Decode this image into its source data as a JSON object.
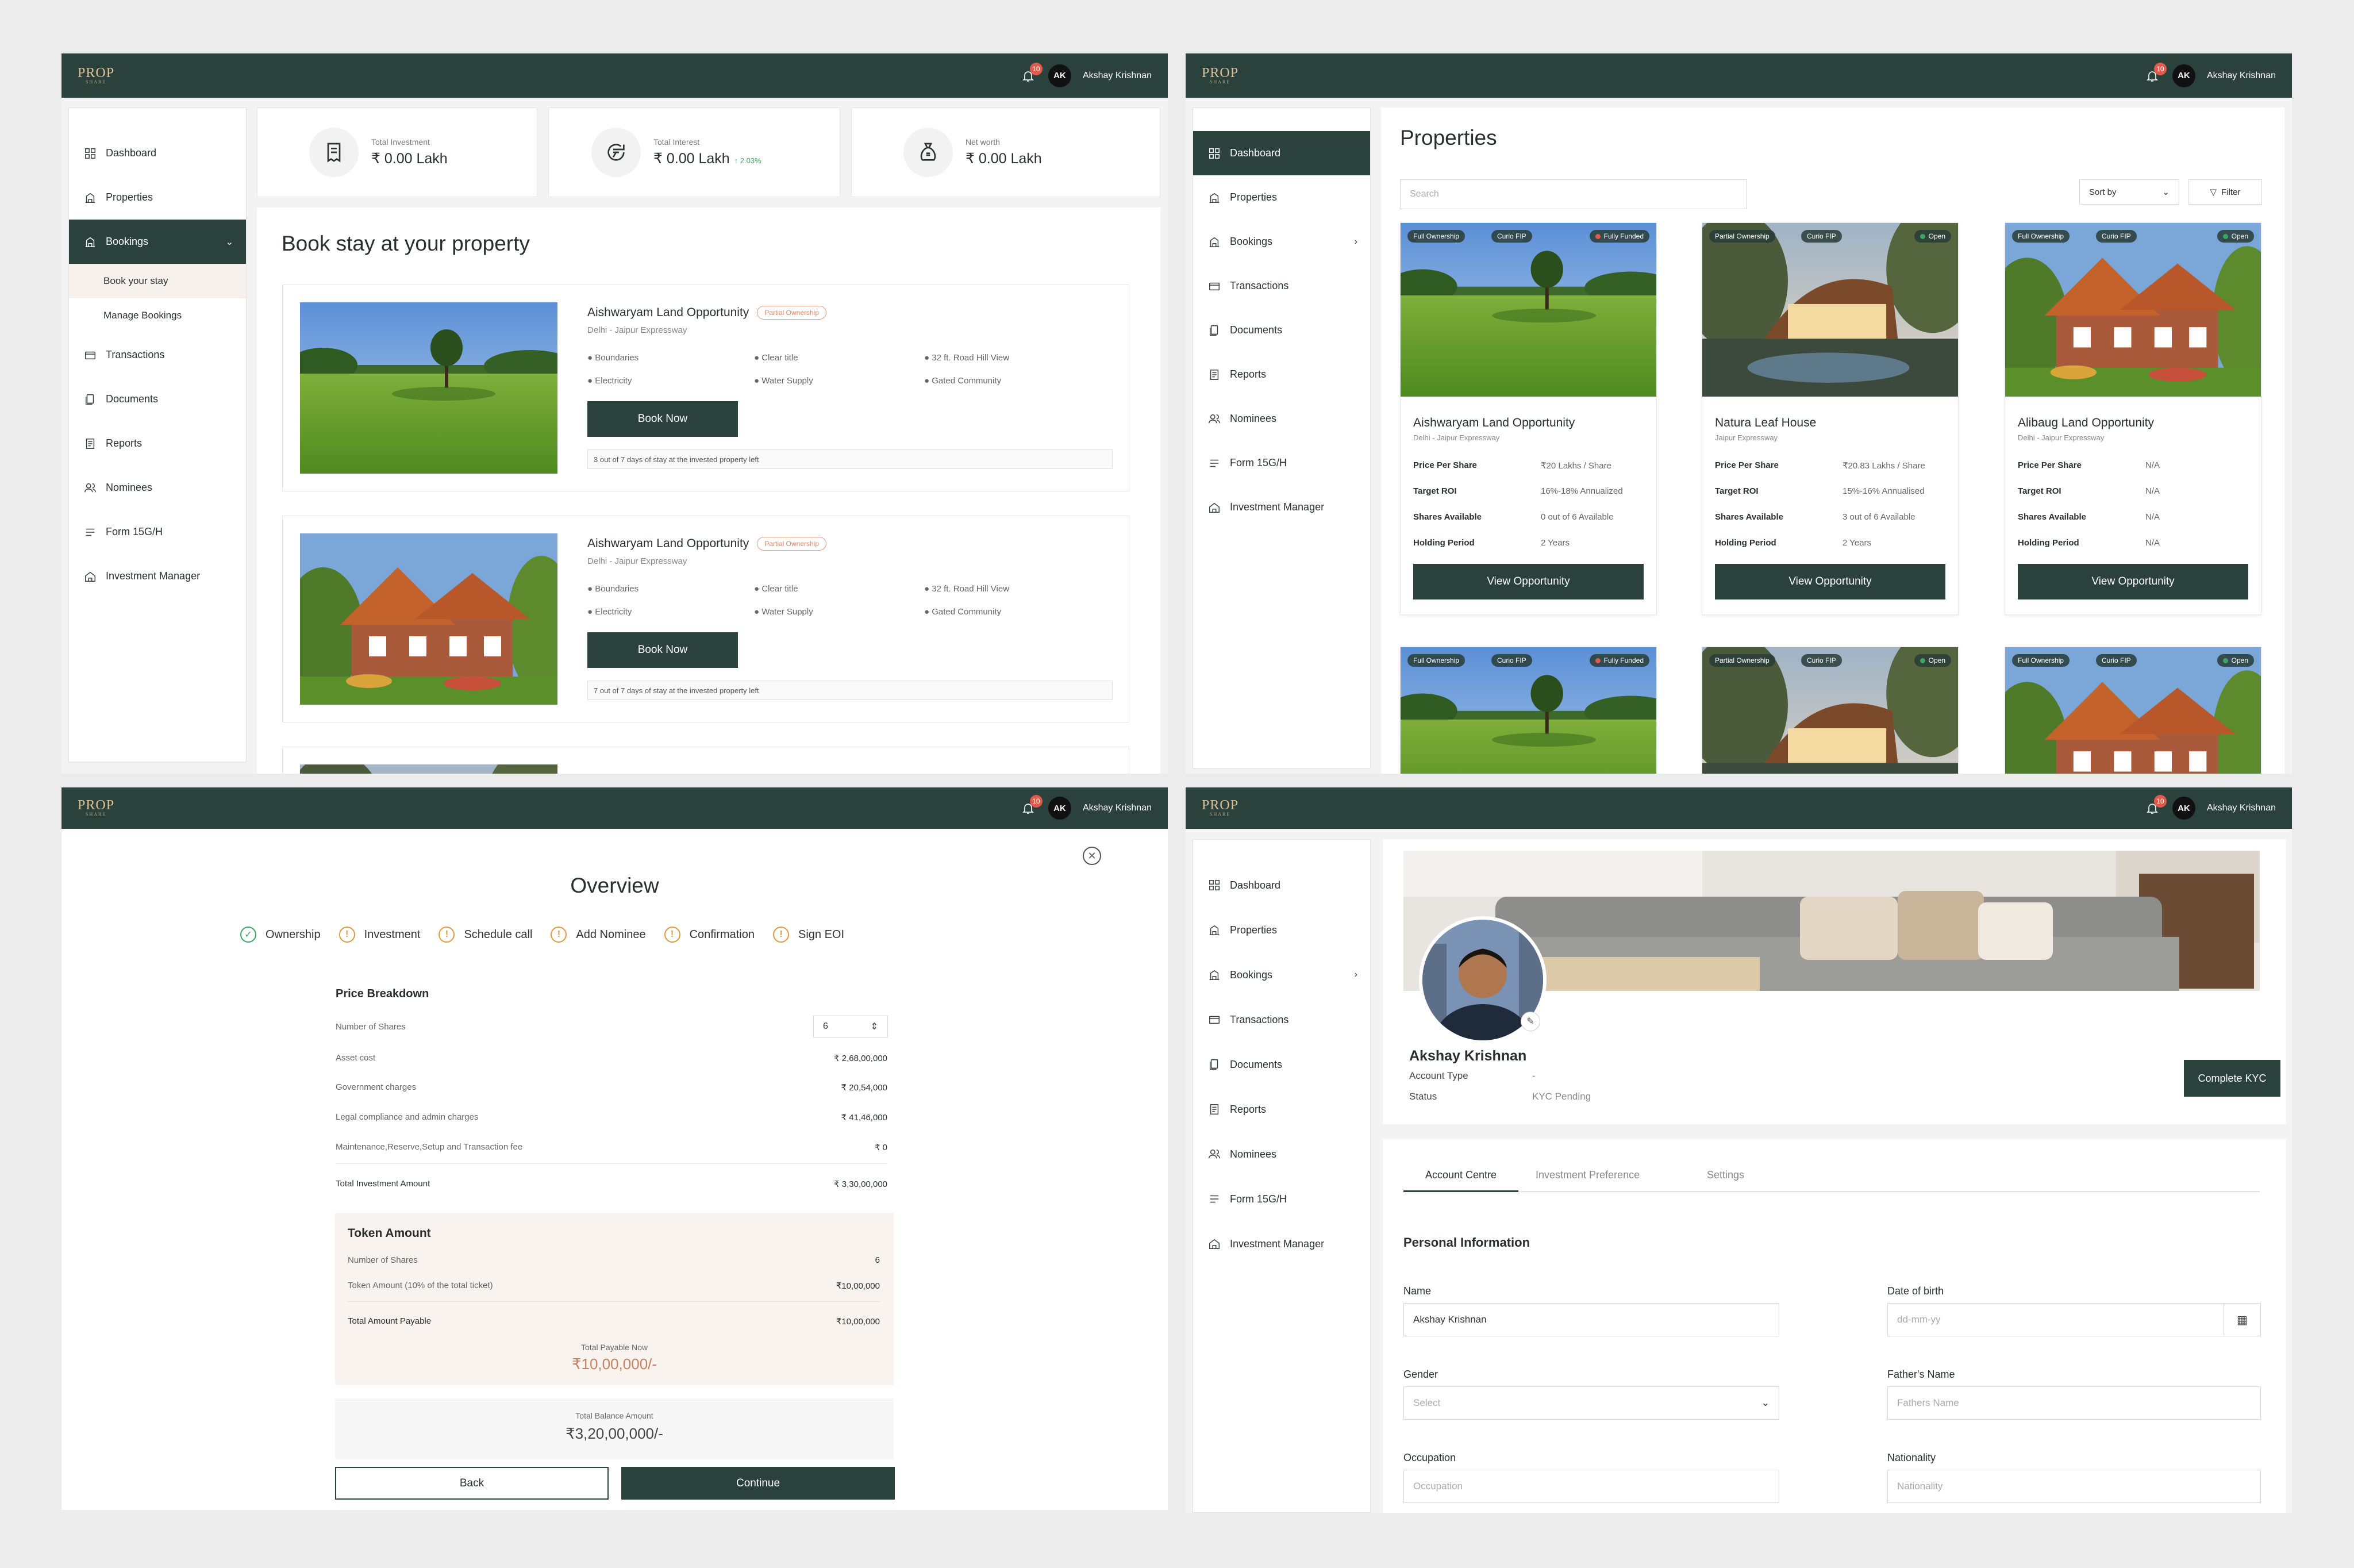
{
  "app": {
    "logo": "PROP",
    "logo_sub": "SHARE",
    "notifications": "10",
    "user_initials": "AK",
    "user_name": "Akshay Krishnan"
  },
  "colors": {
    "brand": "#2a423b",
    "accent": "#d9c09a",
    "warning": "#e09a3f",
    "success": "#3aa662"
  },
  "sidebar": {
    "items": [
      "Dashboard",
      "Properties",
      "Bookings",
      "Transactions",
      "Documents",
      "Reports",
      "Nominees",
      "Form 15G/H",
      "Investment Manager"
    ],
    "sub_items": [
      "Book your stay",
      "Manage Bookings"
    ]
  },
  "stats": [
    {
      "label": "Total Investment",
      "value": "₹ 0.00 Lakh",
      "icon": "receipt-icon"
    },
    {
      "label": "Total Interest",
      "value": "₹ 0.00 Lakh",
      "delta": "↑ 2.03%",
      "icon": "rupee-refresh-icon"
    },
    {
      "label": "Net worth",
      "value": "₹ 0.00 Lakh",
      "icon": "money-bag-icon"
    }
  ],
  "book_stay": {
    "title": "Book stay at your property",
    "properties": [
      {
        "name": "Aishwaryam Land Opportunity",
        "badge": "Partial Ownership",
        "location": "Delhi - Jaipur Expressway",
        "features": [
          "Boundaries",
          "Clear title",
          "32 ft. Road Hill View",
          "Electricity",
          "Water Supply",
          "Gated Community"
        ],
        "button": "Book Now",
        "stay_info": "3 out of 7 days of stay at the invested property left"
      },
      {
        "name": "Aishwaryam Land Opportunity",
        "badge": "Partial Ownership",
        "location": "Delhi - Jaipur Expressway",
        "features": [
          "Boundaries",
          "Clear title",
          "32 ft. Road Hill View",
          "Electricity",
          "Water Supply",
          "Gated Community"
        ],
        "button": "Book Now",
        "stay_info": "7 out of 7 days of stay at the invested property left"
      }
    ]
  },
  "properties_page": {
    "title": "Properties",
    "search_placeholder": "Search",
    "sort_label": "Sort by",
    "filter_label": "Filter",
    "cards": [
      {
        "tags": [
          "Full Ownership",
          "Curio FIP"
        ],
        "status": "Fully Funded",
        "name": "Aishwaryam Land Opportunity",
        "location": "Delhi - Jaipur Expressway",
        "rows": [
          [
            "Price Per Share",
            "₹20 Lakhs / Share"
          ],
          [
            "Target ROI",
            "16%-18% Annualized"
          ],
          [
            "Shares Available",
            "0 out of 6  Available"
          ],
          [
            "Holding Period",
            "2 Years"
          ]
        ],
        "button": "View Opportunity"
      },
      {
        "tags": [
          "Partial Ownership",
          "Curio FIP"
        ],
        "status": "Open",
        "name": "Natura Leaf House",
        "location": "Jaipur Expressway",
        "rows": [
          [
            "Price Per Share",
            "₹20.83 Lakhs / Share"
          ],
          [
            "Target ROI",
            "15%-16% Annualised"
          ],
          [
            "Shares Available",
            "3 out of 6 Available"
          ],
          [
            "Holding Period",
            "2 Years"
          ]
        ],
        "button": "View Opportunity"
      },
      {
        "tags": [
          "Full Ownership",
          "Curio FIP"
        ],
        "status": "Open",
        "name": "Alibaug Land Opportunity",
        "location": "Delhi - Jaipur Expressway",
        "rows": [
          [
            "Price Per Share",
            "N/A"
          ],
          [
            "Target ROI",
            "N/A"
          ],
          [
            "Shares Available",
            "N/A"
          ],
          [
            "Holding Period",
            "N/A"
          ]
        ],
        "button": "View Opportunity"
      }
    ],
    "cards_row2": [
      {
        "tags": [
          "Full Ownership",
          "Curio FIP"
        ],
        "status": "Fully Funded"
      },
      {
        "tags": [
          "Partial Ownership",
          "Curio FIP"
        ],
        "status": "Open"
      },
      {
        "tags": [
          "Full Ownership",
          "Curio FIP"
        ],
        "status": "Open"
      }
    ]
  },
  "overview": {
    "title": "Overview",
    "steps": [
      "Ownership",
      "Investment",
      "Schedule call",
      "Add Nominee",
      "Confirmation",
      "Sign EOI"
    ],
    "price_breakdown_title": "Price Breakdown",
    "shares_label": "Number of Shares",
    "shares_value": "6",
    "rows": [
      [
        "Asset cost",
        "₹ 2,68,00,000"
      ],
      [
        "Government charges",
        "₹ 20,54,000"
      ],
      [
        "Legal compliance and admin charges",
        "₹ 41,46,000"
      ],
      [
        "Maintenance,Reserve,Setup and Transaction fee",
        "₹ 0"
      ]
    ],
    "total_label": "Total Investment Amount",
    "total_value": "₹ 3,30,00,000",
    "token": {
      "title": "Token Amount",
      "rows": [
        [
          "Number of Shares",
          "6"
        ],
        [
          "Token Amount (10% of the total ticket)",
          "₹10,00,000"
        ]
      ],
      "payable_label": "Total Amount Payable",
      "payable_value": "₹10,00,000",
      "now_label": "Total Payable Now",
      "now_value": "₹10,00,000/-"
    },
    "balance_label": "Total Balance Amount",
    "balance_value": "₹3,20,00,000/-",
    "back": "Back",
    "continue": "Continue"
  },
  "profile": {
    "name": "Akshay Krishnan",
    "account_type_label": "Account Type",
    "account_type_value": "-",
    "status_label": "Status",
    "status_value": "KYC Pending",
    "kyc_button": "Complete KYC",
    "tabs": [
      "Account Centre",
      "Investment Preference",
      "Settings"
    ],
    "section_title": "Personal Information",
    "fields": {
      "name_label": "Name",
      "name_value": "Akshay Krishnan",
      "dob_label": "Date of birth",
      "dob_placeholder": "dd-mm-yy",
      "gender_label": "Gender",
      "gender_placeholder": "Select",
      "father_label": "Father's Name",
      "father_placeholder": "Fathers Name",
      "occupation_label": "Occupation",
      "occupation_placeholder": "Occupation",
      "nationality_label": "Nationality",
      "nationality_placeholder": "Nationality"
    }
  }
}
